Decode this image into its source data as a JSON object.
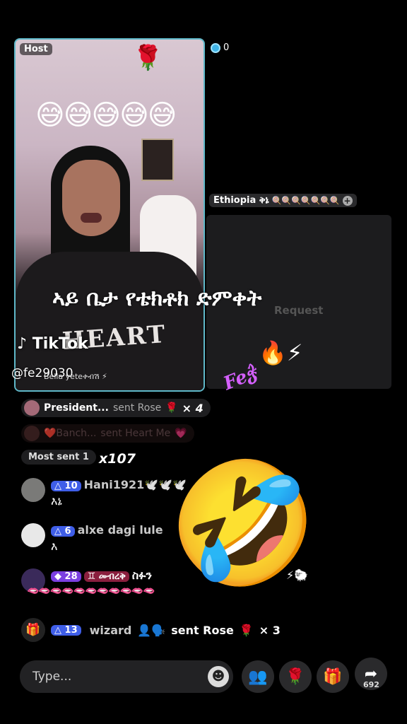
{
  "host": {
    "badge": "Host",
    "top_emoji": "🌹",
    "emoji_row": "😅😅😅😅😅",
    "shirt_print": "HEART"
  },
  "viewer_count": "0",
  "guest": {
    "label": "Ethiopia ቅኔ",
    "label_emojis": "🍭🍭🍭🍭🍭🍭🍭",
    "request": "Request"
  },
  "overlay_text": "ኣይ ቤታ የቴክቶክ ድምቀት",
  "watermark": {
    "logo": "TikTok",
    "user": "@fe29030",
    "under_text": "Bella yeteቀብሽ ⚡"
  },
  "decor": {
    "fire": "🔥⚡",
    "feat": "Feჭ"
  },
  "gifts": [
    {
      "name": "President...",
      "action": "sent Rose",
      "emoji": "🌹",
      "count": "× 4"
    },
    {
      "name": "❤️Banch...",
      "action": "sent Heart Me",
      "emoji": "💗"
    }
  ],
  "most_sent": {
    "label": "Most sent",
    "num": "1",
    "count": "x107"
  },
  "comments": [
    {
      "level": "10",
      "name": "Hani1921",
      "suffix": "🕊️🕊️🕊️",
      "msg": "እኔ",
      "avatar_color": "#7a7a78"
    },
    {
      "level": "6",
      "name": "alxe dagi lule",
      "msg": "እ",
      "avatar_color": "#e8e8e8"
    },
    {
      "level": "28",
      "tag": "♊ መብረቅ",
      "name": "ስፉን",
      "suffix": "⚡🐑",
      "msg": "🫦🫦🫦🫦🫦🫦🫦🫦🫦🫦🫦",
      "avatar_color": "#3a2a5a"
    }
  ],
  "big_emoji": "🤣",
  "system": {
    "gift_icon": "🎁",
    "level": "13",
    "name": "wizard",
    "emoji": "👤🗣️",
    "action": "sent Rose",
    "gift": "🌹",
    "count": "× 3"
  },
  "input": {
    "placeholder": "Type..."
  },
  "buttons": {
    "emoji_icon": "☻",
    "cohost_icon": "👥",
    "rose_icon": "🌹",
    "gift_icon": "🎁",
    "share_icon": "➦",
    "share_count": "692"
  },
  "colors": {
    "accent_blue": "#3f5ee8",
    "tile_border": "#5fb8c9",
    "pink": "#d560ff"
  }
}
